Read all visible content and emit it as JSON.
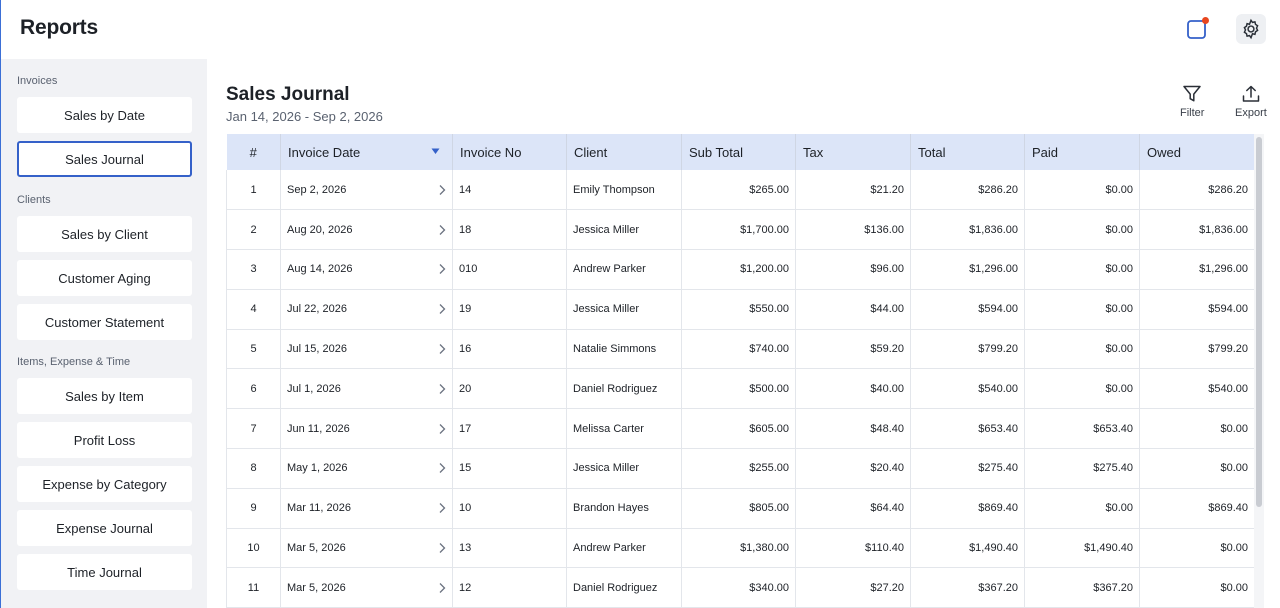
{
  "header": {
    "title": "Reports"
  },
  "sidebar": {
    "sections": [
      {
        "label": "Invoices"
      },
      {
        "label": "Clients"
      },
      {
        "label": "Items, Expense & Time"
      }
    ],
    "items": [
      {
        "label": "Sales by Date"
      },
      {
        "label": "Sales Journal",
        "active": true
      },
      {
        "label": "Sales by Client"
      },
      {
        "label": "Customer Aging"
      },
      {
        "label": "Customer Statement"
      },
      {
        "label": "Sales by Item"
      },
      {
        "label": "Profit Loss"
      },
      {
        "label": "Expense by Category"
      },
      {
        "label": "Expense Journal"
      },
      {
        "label": "Time Journal"
      }
    ]
  },
  "report": {
    "title": "Sales Journal",
    "range": "Jan 14, 2026 - Sep 2, 2026",
    "filter_label": "Filter",
    "export_label": "Export"
  },
  "table": {
    "columns": [
      "#",
      "Invoice Date",
      "Invoice No",
      "Client",
      "Sub Total",
      "Tax",
      "Total",
      "Paid",
      "Owed"
    ],
    "sort_column": "Invoice Date",
    "rows": [
      {
        "n": "1",
        "date": "Sep 2, 2026",
        "invoice": "14",
        "client": "Emily Thompson",
        "subtotal": "$265.00",
        "tax": "$21.20",
        "total": "$286.20",
        "paid": "$0.00",
        "owed": "$286.20"
      },
      {
        "n": "2",
        "date": "Aug 20, 2026",
        "invoice": "18",
        "client": "Jessica Miller",
        "subtotal": "$1,700.00",
        "tax": "$136.00",
        "total": "$1,836.00",
        "paid": "$0.00",
        "owed": "$1,836.00"
      },
      {
        "n": "3",
        "date": "Aug 14, 2026",
        "invoice": "010",
        "client": "Andrew Parker",
        "subtotal": "$1,200.00",
        "tax": "$96.00",
        "total": "$1,296.00",
        "paid": "$0.00",
        "owed": "$1,296.00"
      },
      {
        "n": "4",
        "date": "Jul 22, 2026",
        "invoice": "19",
        "client": "Jessica Miller",
        "subtotal": "$550.00",
        "tax": "$44.00",
        "total": "$594.00",
        "paid": "$0.00",
        "owed": "$594.00"
      },
      {
        "n": "5",
        "date": "Jul 15, 2026",
        "invoice": "16",
        "client": "Natalie Simmons",
        "subtotal": "$740.00",
        "tax": "$59.20",
        "total": "$799.20",
        "paid": "$0.00",
        "owed": "$799.20"
      },
      {
        "n": "6",
        "date": "Jul 1, 2026",
        "invoice": "20",
        "client": "Daniel Rodriguez",
        "subtotal": "$500.00",
        "tax": "$40.00",
        "total": "$540.00",
        "paid": "$0.00",
        "owed": "$540.00"
      },
      {
        "n": "7",
        "date": "Jun 11, 2026",
        "invoice": "17",
        "client": "Melissa Carter",
        "subtotal": "$605.00",
        "tax": "$48.40",
        "total": "$653.40",
        "paid": "$653.40",
        "owed": "$0.00"
      },
      {
        "n": "8",
        "date": "May 1, 2026",
        "invoice": "15",
        "client": "Jessica Miller",
        "subtotal": "$255.00",
        "tax": "$20.40",
        "total": "$275.40",
        "paid": "$275.40",
        "owed": "$0.00"
      },
      {
        "n": "9",
        "date": "Mar 11, 2026",
        "invoice": "10",
        "client": "Brandon Hayes",
        "subtotal": "$805.00",
        "tax": "$64.40",
        "total": "$869.40",
        "paid": "$0.00",
        "owed": "$869.40"
      },
      {
        "n": "10",
        "date": "Mar 5, 2026",
        "invoice": "13",
        "client": "Andrew Parker",
        "subtotal": "$1,380.00",
        "tax": "$110.40",
        "total": "$1,490.40",
        "paid": "$1,490.40",
        "owed": "$0.00"
      },
      {
        "n": "11",
        "date": "Mar 5, 2026",
        "invoice": "12",
        "client": "Daniel Rodriguez",
        "subtotal": "$340.00",
        "tax": "$27.20",
        "total": "$367.20",
        "paid": "$367.20",
        "owed": "$0.00"
      }
    ]
  },
  "icons": {
    "notification": "notification-icon",
    "settings": "gear-icon",
    "filter": "filter-icon",
    "export": "upload-icon",
    "sort": "sort-down-icon",
    "row_chevron": "chevron-right-icon"
  },
  "colors": {
    "accent": "#3561c9",
    "notification_dot": "#e8461e",
    "table_header_bg": "#dce5f8",
    "sidebar_bg": "#f1f2f5"
  }
}
